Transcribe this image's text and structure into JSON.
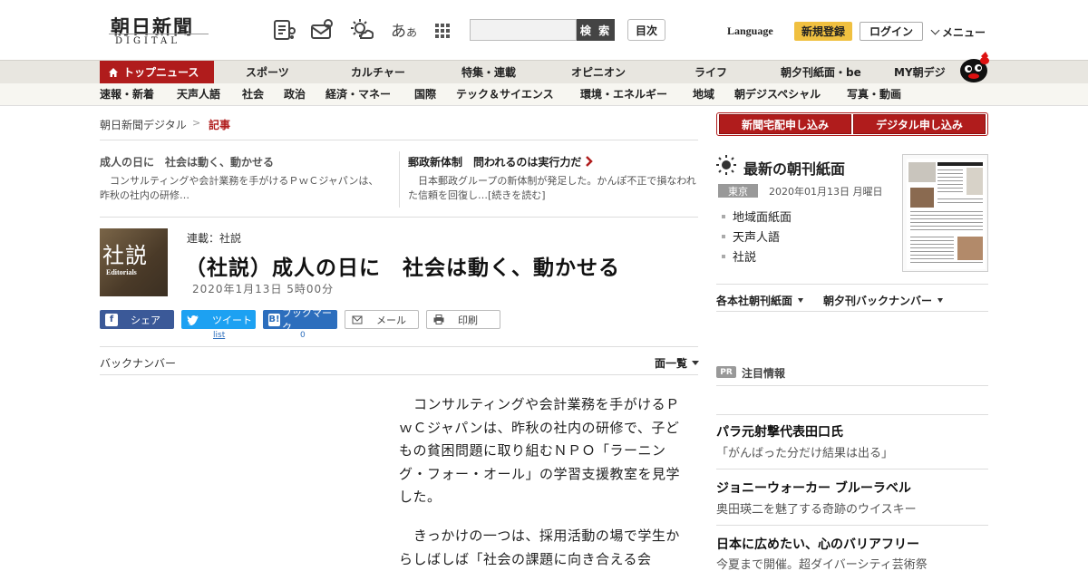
{
  "header": {
    "logo_main": "朝日新聞",
    "logo_sub": "DIGITAL",
    "font_toggle": "あ",
    "font_toggle_small": "あ",
    "search_placeholder": "",
    "search_label": "検 索",
    "toc_label": "目次",
    "language_label": "Language",
    "signup_label": "新規登録",
    "login_label": "ログイン",
    "menu_label": "メニュー",
    "icons": [
      "news-reader-icon",
      "mail-box-icon",
      "weather-icon",
      "font-size-icon",
      "apps-grid-icon"
    ]
  },
  "nav_primary": [
    {
      "label": "トップニュース",
      "active": true
    },
    {
      "label": "スポーツ"
    },
    {
      "label": "カルチャー"
    },
    {
      "label": "特集・連載"
    },
    {
      "label": "オピニオン"
    },
    {
      "label": "ライフ"
    },
    {
      "label": "朝夕刊紙面・be"
    },
    {
      "label": "MY朝デジ"
    }
  ],
  "nav_secondary": [
    "速報・新着",
    "天声人語",
    "社会",
    "政治",
    "経済・マネー",
    "国際",
    "テック＆サイエンス",
    "環境・エネルギー",
    "地域",
    "朝デジスペシャル",
    "写真・動画"
  ],
  "breadcrumb": {
    "home": "朝日新聞デジタル",
    "sep": ">",
    "current": "記事"
  },
  "featured": [
    {
      "title": "成人の日に　社会は動く、動かせる",
      "body": "コンサルティングや会計業務を手がけるＰｗＣジャパンは、昨秋の社内の研修…"
    },
    {
      "title": "郵政新体制　問われるのは実行力だ",
      "body": "日本郵政グループの新体制が発足した。かんぽ不正で損なわれた信頼を回復し…[続きを読む]"
    }
  ],
  "article": {
    "thumb_kanji": "社説",
    "thumb_en": "Editorials",
    "series": "連載：社説",
    "headline": "（社説）成人の日に　社会は動く、動かせる",
    "date": "2020年1月13日 5時00分",
    "share": {
      "facebook": "シェア",
      "twitter": "ツイート",
      "hatena": "ブックマーク",
      "mail": "メール",
      "print": "印刷",
      "twitter_count": "list",
      "hatena_count": "0"
    },
    "backnumber": "バックナンバー",
    "menlist": "面一覧",
    "paragraphs": [
      "コンサルティングや会計業務を手がけるＰｗＣジャパンは、昨秋の社内の研修で、子どもの貧困問題に取り組むＮＰＯ「ラーニング・フォー・オール」の学習支援教室を見学した。",
      "きっかけの一つは、採用活動の場で学生からしばしば「社会の課題に向き合える会"
    ]
  },
  "sidebar": {
    "home_delivery": "新聞宅配申し込み",
    "digital_signup": "デジタル申し込み",
    "paper_title": "最新の朝刊紙面",
    "region": "東京",
    "paper_date": "2020年01月13日 月曜日",
    "paper_links": [
      "地域面紙面",
      "天声人語",
      "社説"
    ],
    "dropdown_1": "各本社朝刊紙面",
    "dropdown_2": "朝夕刊バックナンバー",
    "pr_badge": "PR",
    "pr_title": "注目情報",
    "ads": [
      {
        "title": "パラ元射撃代表田口氏",
        "sub": "「がんばった分だけ結果は出る」"
      },
      {
        "title": "ジョニーウォーカー ブルーラベル",
        "sub": "奥田瑛二を魅了する奇跡のウイスキー"
      },
      {
        "title": "日本に広めたい、心のバリアフリー",
        "sub": "今夏まで開催。超ダイバーシティ芸術祭"
      }
    ]
  },
  "colors": {
    "brand_red": "#b01c1c",
    "signup_yellow": "#f0c040",
    "facebook": "#3b5998",
    "twitter": "#1da1f2",
    "hatena": "#2c6ebd"
  }
}
